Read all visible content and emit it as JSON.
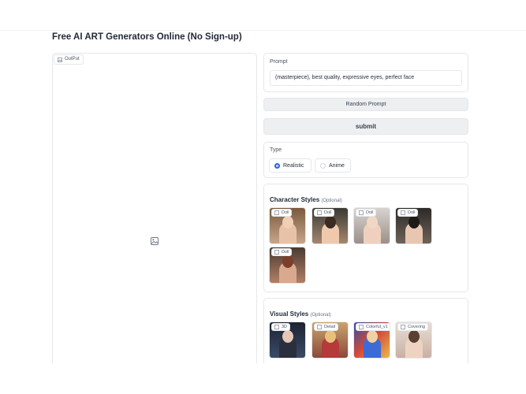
{
  "page": {
    "title": "Free AI ART Generators Online (No Sign-up)"
  },
  "output": {
    "label": "OutPut"
  },
  "prompt": {
    "label": "Prompt",
    "value": "(masterpiece), best quality, expressive eyes, perfect face"
  },
  "buttons": {
    "random": "Random Prompt",
    "submit": "submit"
  },
  "type": {
    "label": "Type",
    "options": [
      {
        "label": "Realistic",
        "checked": true
      },
      {
        "label": "Anime",
        "checked": false
      }
    ]
  },
  "character_styles": {
    "title": "Character Styles",
    "optional": "(Optional)",
    "items": [
      {
        "label": "Doll"
      },
      {
        "label": "Doll"
      },
      {
        "label": "Doll"
      },
      {
        "label": "Doll"
      },
      {
        "label": "Doll"
      }
    ]
  },
  "visual_styles": {
    "title": "Visual Styles",
    "optional": "(Optional)",
    "items": [
      {
        "label": "3D"
      },
      {
        "label": "Detail"
      },
      {
        "label": "Colorful_v1"
      },
      {
        "label": "Covering"
      }
    ]
  },
  "colors": {
    "accent": "#2563eb",
    "border": "#e5e7eb",
    "button_bg": "#eeeff1"
  }
}
